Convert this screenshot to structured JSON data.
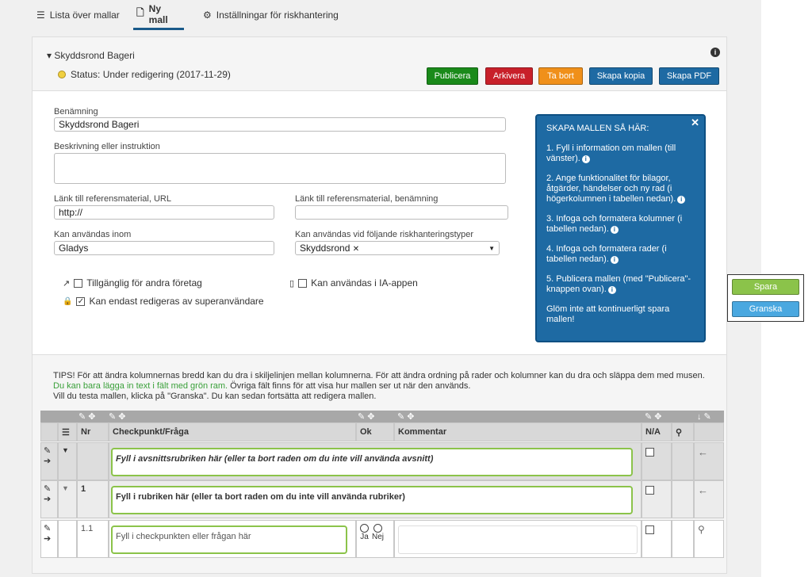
{
  "tabs": [
    {
      "label": "Lista över mallar"
    },
    {
      "label": "Ny mall"
    },
    {
      "label": "Inställningar för riskhantering"
    }
  ],
  "template_name": "Skyddsrond Bageri",
  "status": "Status: Under redigering (2017-11-29)",
  "actions": {
    "publish": "Publicera",
    "archive": "Arkivera",
    "delete": "Ta bort",
    "copy": "Skapa kopia",
    "pdf": "Skapa PDF"
  },
  "form": {
    "name_label": "Benämning",
    "name_value": "Skyddsrond Bageri",
    "desc_label": "Beskrivning eller instruktion",
    "url_label": "Länk till referensmaterial, URL",
    "url_value": "http://",
    "refname_label": "Länk till referensmaterial, benämning",
    "usable_label": "Kan användas inom",
    "usable_value": "Gladys",
    "risktype_label": "Kan användas vid följande riskhanteringstyper",
    "risktype_tag": "Skyddsrond",
    "cb_available": "Tillgänglig för andra företag",
    "cb_ia": "Kan användas i IA-appen",
    "cb_super": "Kan endast redigeras av superanvändare"
  },
  "help": {
    "title": "SKAPA MALLEN SÅ HÄR:",
    "s1": "1. Fyll i information om mallen (till vänster).",
    "s2": "2. Ange funktionalitet för bilagor, åtgärder, händelser och ny rad (i högerkolumnen i tabellen nedan).",
    "s3": "3. Infoga och formatera kolumner (i tabellen nedan).",
    "s4": "4. Infoga och formatera rader (i tabellen nedan).",
    "s5": "5. Publicera mallen (med \"Publicera\"-knappen ovan).",
    "s6": "Glöm inte att kontinuerligt spara mallen!"
  },
  "tips": {
    "t1": "TIPS! För att ändra kolumnernas bredd kan du dra i skiljelinjen mellan kolumnerna. För att ändra ordning på rader och kolumner kan du dra och släppa dem med musen.",
    "t2g": "Du kan bara lägga in text i fält med grön ram.",
    "t2": " Övriga fält finns för att visa hur mallen ser ut när den används.",
    "t3": "Vill du testa mallen, klicka på \"Granska\". Du kan sedan fortsätta att redigera mallen."
  },
  "table": {
    "h_nr": "Nr",
    "h_check": "Checkpunkt/Fråga",
    "h_ok": "Ok",
    "h_comment": "Kommentar",
    "h_na": "N/A",
    "r1_text": "Fyll i avsnittsrubriken här (eller ta bort raden om du inte vill använda avsnitt)",
    "r2_nr": "1",
    "r2_text": "Fyll i rubriken här (eller ta bort raden om du inte vill använda rubriker)",
    "r3_nr": "1.1",
    "r3_text": "Fyll i checkpunkten eller frågan här",
    "r3_yes": "Ja",
    "r3_no": "Nej"
  },
  "side": {
    "save": "Spara",
    "review": "Granska"
  },
  "colors": {
    "publish": "#1a8a1a",
    "archive": "#c8202a",
    "delete": "#f0901a",
    "blue": "#1e6aa3",
    "save": "#8bc34a",
    "review": "#4aa8e0"
  }
}
